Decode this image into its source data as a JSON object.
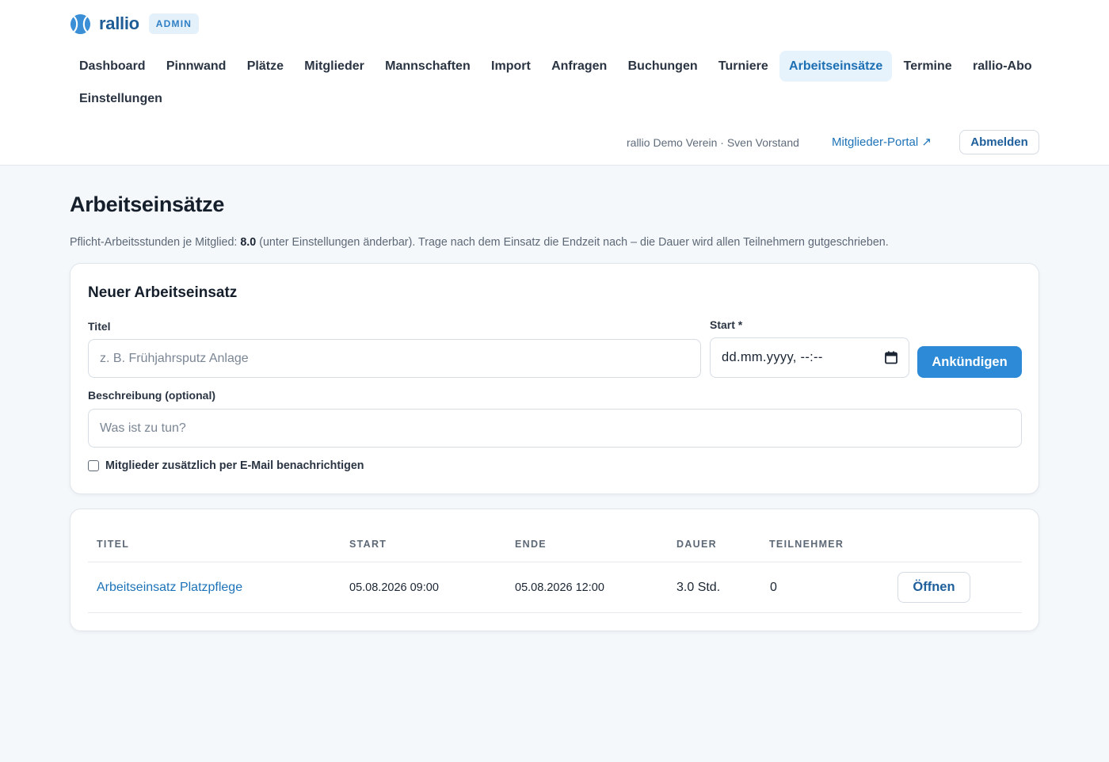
{
  "brand": {
    "name": "rallio",
    "badge": "ADMIN",
    "logo_icon": "tennis-ball-icon"
  },
  "nav": {
    "items": [
      {
        "label": "Dashboard",
        "active": false
      },
      {
        "label": "Pinnwand",
        "active": false
      },
      {
        "label": "Plätze",
        "active": false
      },
      {
        "label": "Mitglieder",
        "active": false
      },
      {
        "label": "Mannschaften",
        "active": false
      },
      {
        "label": "Import",
        "active": false
      },
      {
        "label": "Anfragen",
        "active": false
      },
      {
        "label": "Buchungen",
        "active": false
      },
      {
        "label": "Turniere",
        "active": false
      },
      {
        "label": "Arbeitseinsätze",
        "active": true
      },
      {
        "label": "Termine",
        "active": false
      },
      {
        "label": "rallio-Abo",
        "active": false
      },
      {
        "label": "Einstellungen",
        "active": false
      }
    ]
  },
  "user": {
    "info": "rallio Demo Verein · Sven Vorstand",
    "portal_link": "Mitglieder-Portal ↗",
    "logout": "Abmelden"
  },
  "page": {
    "title": "Arbeitseinsätze",
    "info_prefix": "Pflicht-Arbeitsstunden je Mitglied: ",
    "info_value": "8.0",
    "info_suffix": " (unter Einstellungen änderbar). Trage nach dem Einsatz die Endzeit nach – die Dauer wird allen Teilnehmern gutgeschrieben."
  },
  "form": {
    "heading": "Neuer Arbeitseinsatz",
    "title_label": "Titel",
    "title_placeholder": "z. B. Frühjahrsputz Anlage",
    "start_label": "Start *",
    "start_placeholder": "dd.mm.yyyy, --:--",
    "submit": "Ankündigen",
    "description_label": "Beschreibung (optional)",
    "description_placeholder": "Was ist zu tun?",
    "notify_label": "Mitglieder zusätzlich per E-Mail benachrichtigen",
    "notify_checked": false
  },
  "table": {
    "headers": [
      "TITEL",
      "START",
      "ENDE",
      "DAUER",
      "TEILNEHMER"
    ],
    "rows": [
      {
        "title": "Arbeitseinsatz Platzpflege",
        "start": "05.08.2026 09:00",
        "end": "05.08.2026 12:00",
        "duration": "3.0 Std.",
        "participants": "0",
        "action": "Öffnen"
      }
    ]
  },
  "colors": {
    "accent": "#2d8ad6",
    "brand": "#1f5d97",
    "active_nav_bg": "#e6f2fc"
  }
}
